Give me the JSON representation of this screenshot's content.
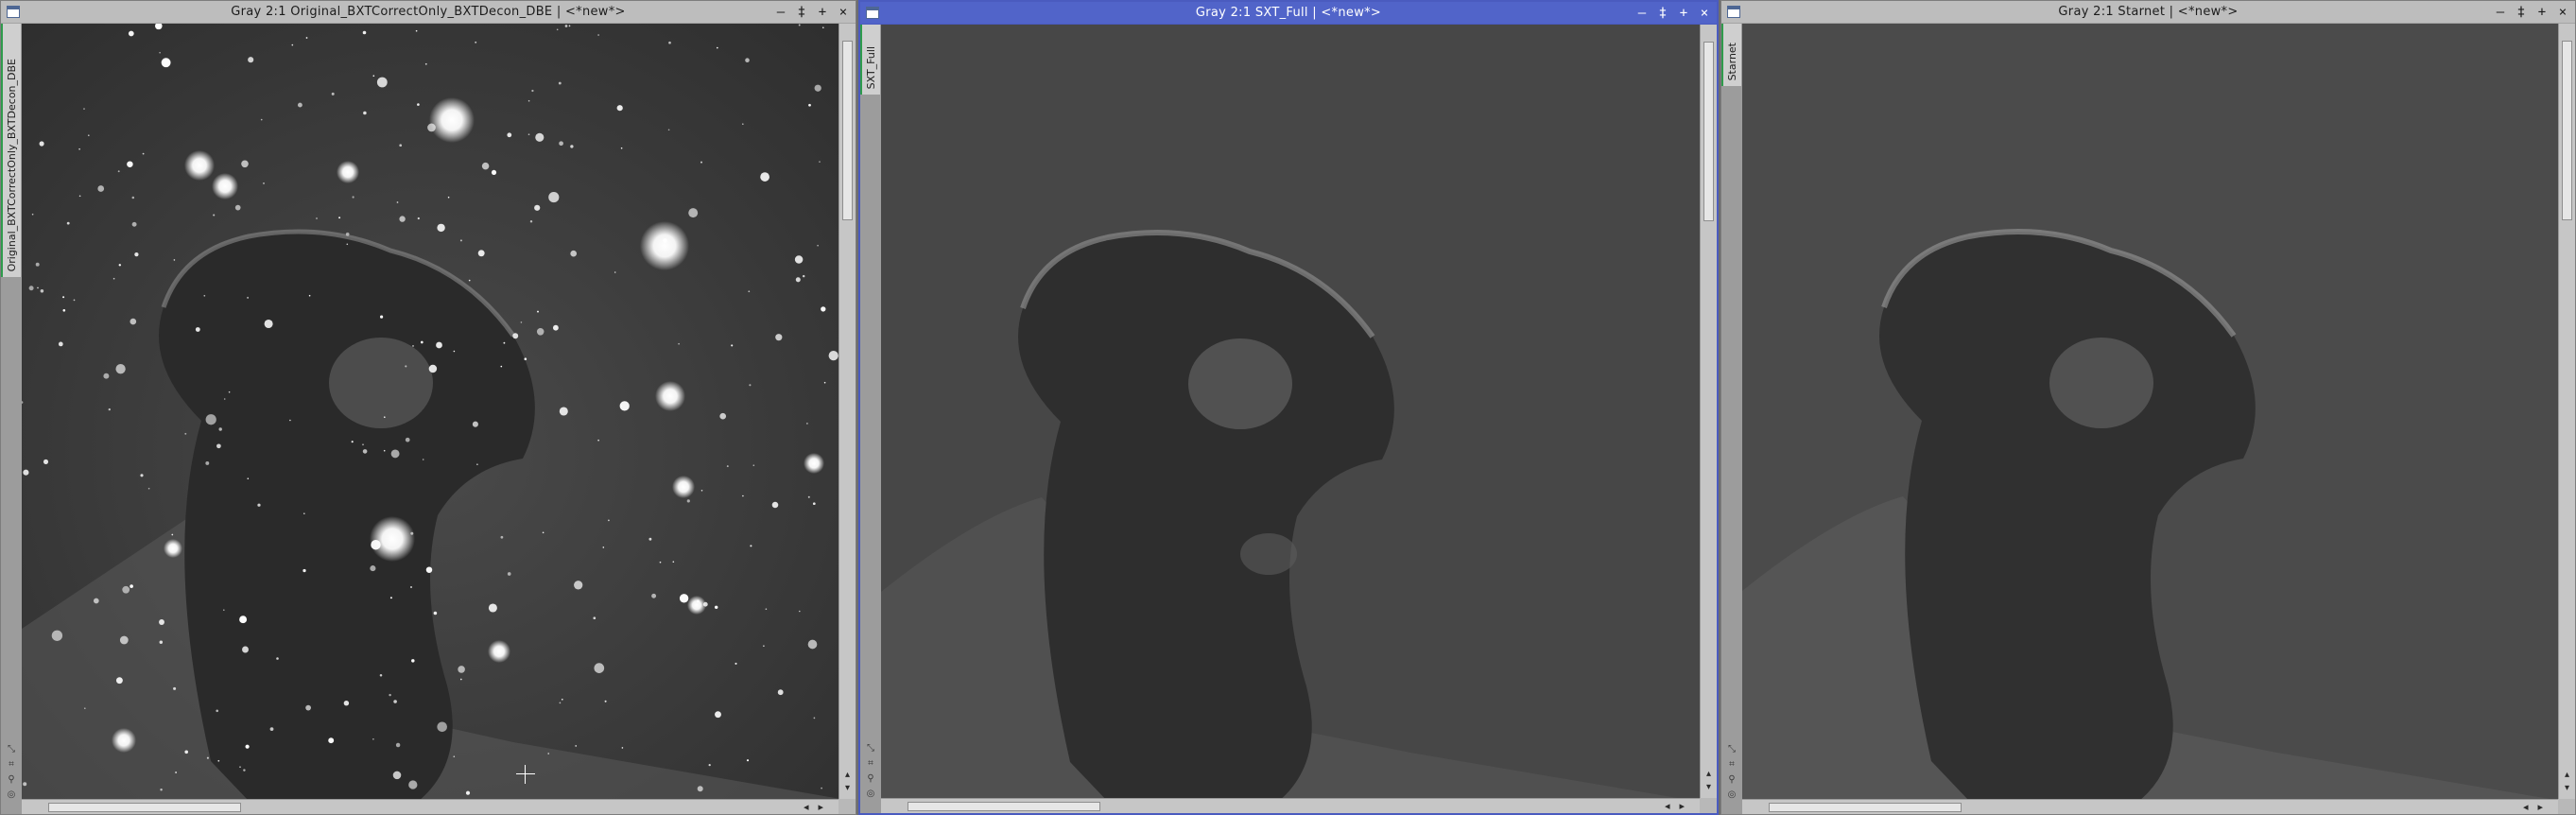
{
  "windows": [
    {
      "title": "Gray 2:1 Original_BXTCorrectOnly_BXTDecon_DBE | <*new*>",
      "tab_label": "Original_BXTCorrectOnly_BXTDecon_DBE",
      "active": false,
      "image": "nebula with stars"
    },
    {
      "title": "Gray 2:1 SXT_Full | <*new*>",
      "tab_label": "SXT_Full",
      "active": true,
      "image": "starless nebula"
    },
    {
      "title": "Gray 2:1 Starnet | <*new*>",
      "tab_label": "Starnet",
      "active": false,
      "image": "starless nebula"
    }
  ],
  "title_buttons": {
    "minimize": "–",
    "shade": "‡",
    "maximize": "+",
    "close": "×"
  },
  "scroll_arrows": {
    "left": "◂",
    "right": "▸",
    "up": "▴",
    "down": "▾"
  },
  "tool_icons": [
    "zoom-to-fit-icon",
    "fit-view-icon",
    "zoom-icon",
    "lock-icon"
  ],
  "colors": {
    "active_title": "#5164c9",
    "inactive_title": "#bdbdbd",
    "tab_accent": "#2f9b4c"
  }
}
